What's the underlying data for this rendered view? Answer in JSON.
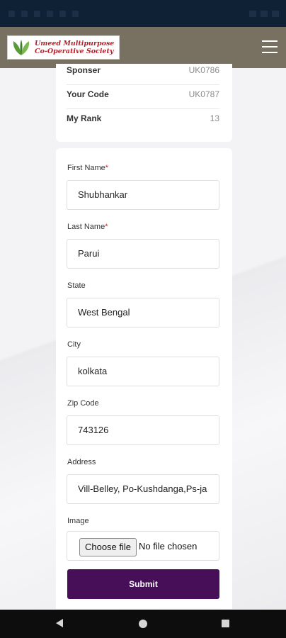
{
  "header": {
    "logo_line1": "Umeed Multipurpose",
    "logo_line2": "Co-Operative Society",
    "menu_icon": "hamburger-menu-icon",
    "colors": {
      "header_bg": "#787060",
      "status_bg": "#0f2135",
      "brand_red": "#b3202a",
      "logo_green": "#5a9a3a"
    }
  },
  "info": {
    "rows": [
      {
        "label": "Sponser",
        "value": "UK0786"
      },
      {
        "label": "Your Code",
        "value": "UK0787"
      },
      {
        "label": "My Rank",
        "value": "13"
      }
    ]
  },
  "form": {
    "first_name": {
      "label": "First Name",
      "required": "*",
      "value": "Shubhankar"
    },
    "last_name": {
      "label": "Last Name",
      "required": "*",
      "value": "Parui"
    },
    "state": {
      "label": "State",
      "value": "West Bengal"
    },
    "city": {
      "label": "City",
      "value": "kolkata"
    },
    "zip": {
      "label": "Zip Code",
      "value": "743126"
    },
    "address": {
      "label": "Address",
      "value": "Vill-Belley, Po-Kushdanga,Ps-ja"
    },
    "image": {
      "label": "Image",
      "choose_label": "Choose file",
      "status": "No file chosen"
    },
    "submit_label": "Submit",
    "colors": {
      "submit_bg": "#470f58",
      "required": "#c0292f"
    }
  },
  "nav": {
    "back_icon": "back-triangle-icon",
    "home_icon": "home-circle-icon",
    "recent_icon": "recent-apps-square-icon"
  }
}
